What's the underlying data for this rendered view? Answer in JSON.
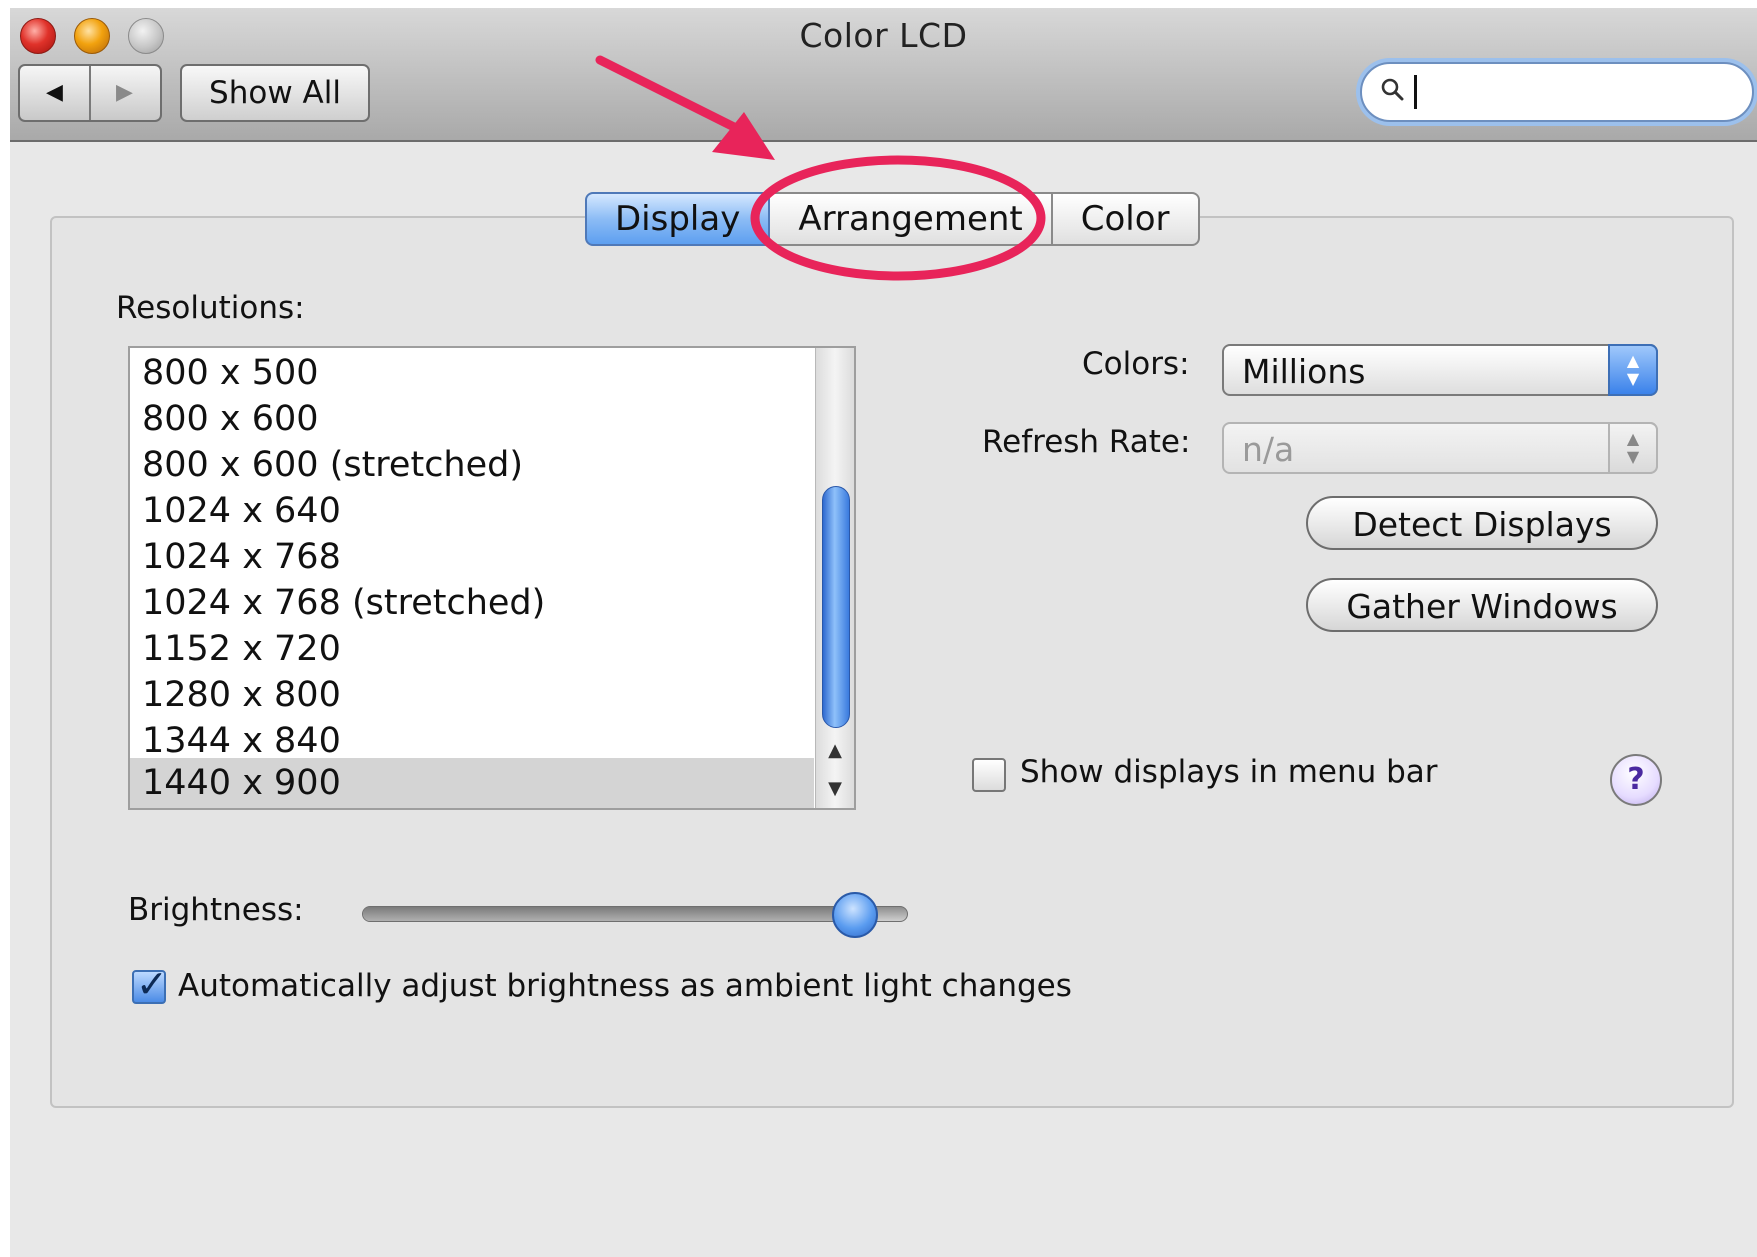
{
  "window": {
    "title": "Color LCD"
  },
  "toolbar": {
    "back_icon": "◀",
    "forward_icon": "▶",
    "show_all_label": "Show All",
    "search": {
      "value": "",
      "placeholder": ""
    }
  },
  "tabs": [
    {
      "label": "Display",
      "selected": true
    },
    {
      "label": "Arrangement",
      "selected": false
    },
    {
      "label": "Color",
      "selected": false
    }
  ],
  "resolutions": {
    "label": "Resolutions:",
    "items": [
      "800 x 500",
      "800 x 600",
      "800 x 600 (stretched)",
      "1024 x 640",
      "1024 x 768",
      "1024 x 768 (stretched)",
      "1152 x 720",
      "1280 x 800",
      "1344 x 840",
      "1440 x 900"
    ],
    "selected": "1440 x 900"
  },
  "colors": {
    "label": "Colors:",
    "value": "Millions"
  },
  "refresh_rate": {
    "label": "Refresh Rate:",
    "value": "n/a"
  },
  "buttons": {
    "detect_displays": "Detect Displays",
    "gather_windows": "Gather Windows"
  },
  "show_displays": {
    "label": "Show displays in menu bar",
    "checked": false
  },
  "help": {
    "label": "?"
  },
  "brightness": {
    "label": "Brightness:",
    "level": 0.9
  },
  "auto_brightness": {
    "label": "Automatically adjust brightness as ambient light changes",
    "checked": true
  },
  "annotation_color": "#e8245a",
  "accent_color": "#3b82ea"
}
